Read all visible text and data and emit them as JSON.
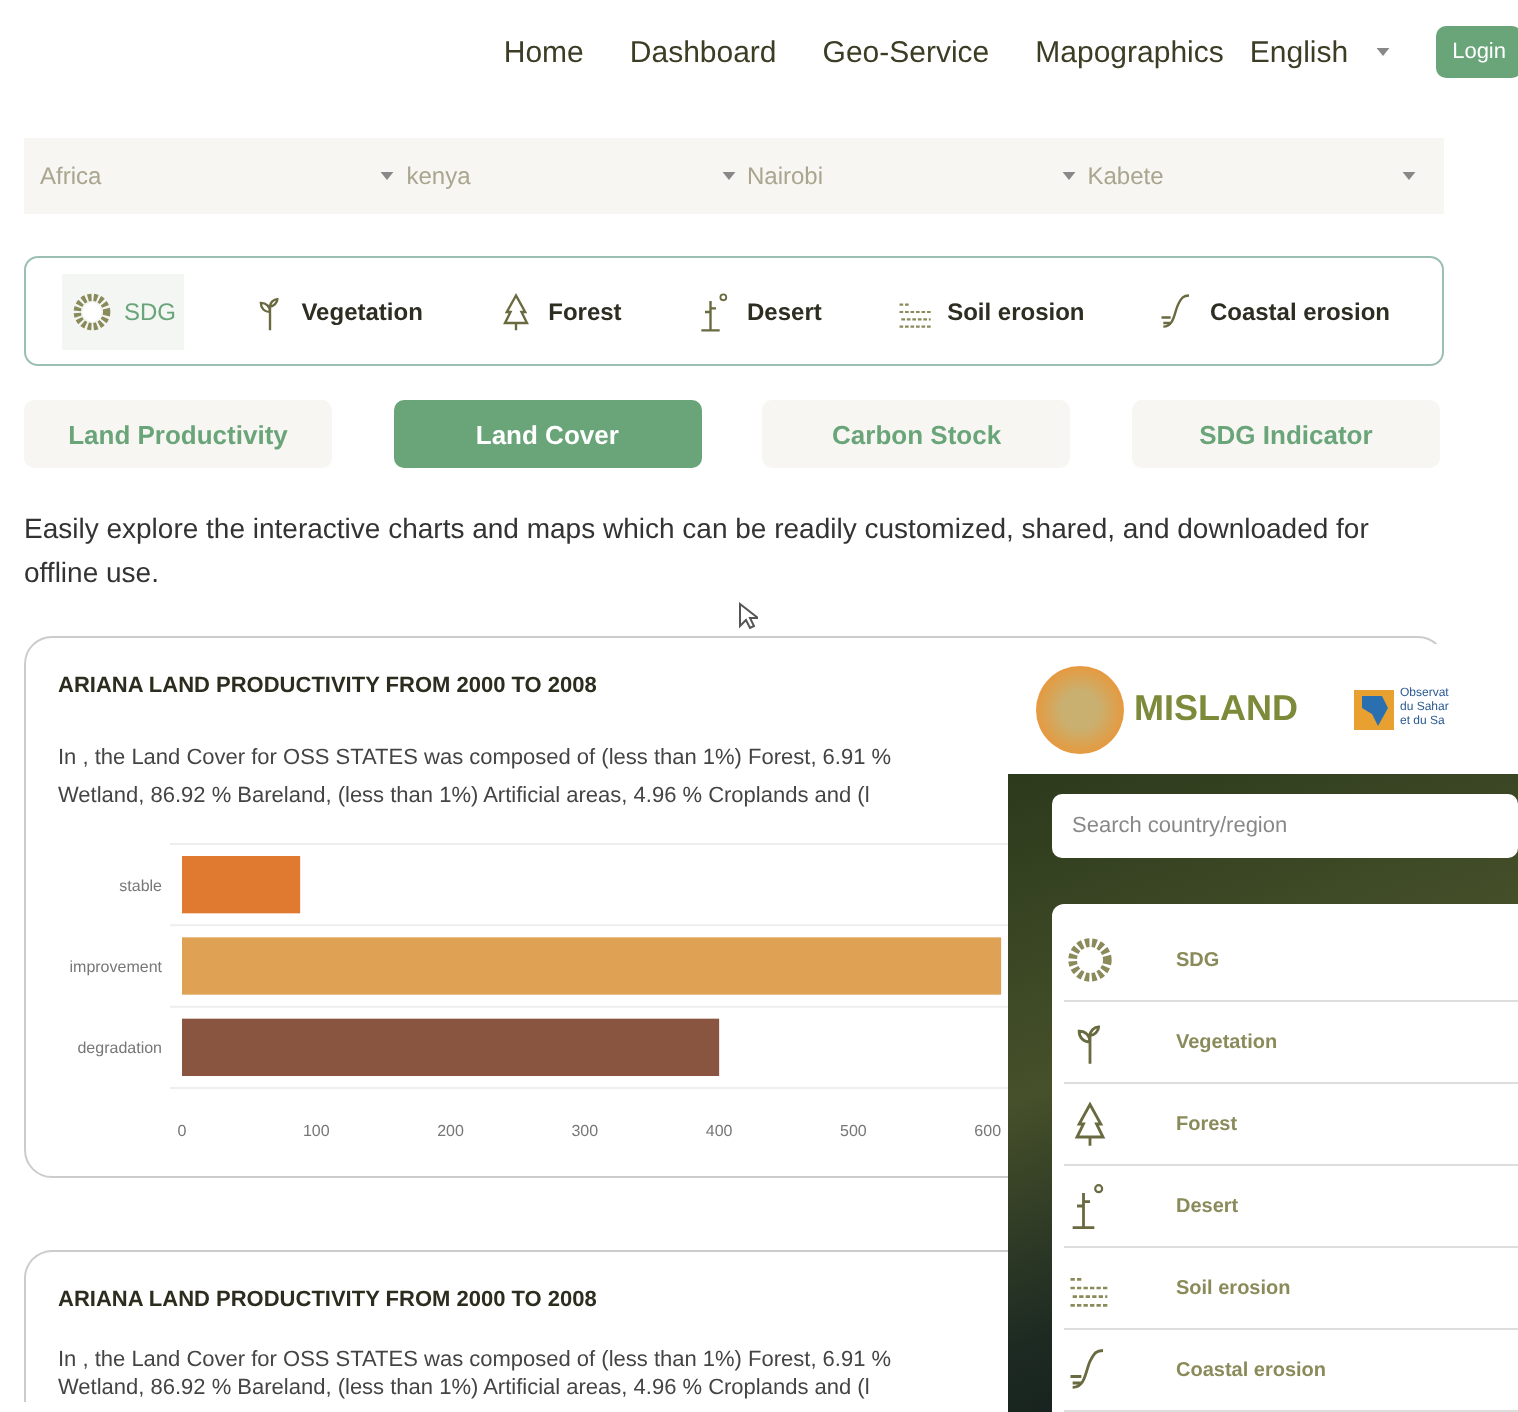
{
  "nav": {
    "links": [
      {
        "label": "Home"
      },
      {
        "label": "Dashboard"
      },
      {
        "label": "Geo-Service"
      },
      {
        "label": "Mapographics"
      }
    ],
    "language": "English",
    "login": "Login"
  },
  "filters": [
    {
      "value": "Africa"
    },
    {
      "value": "kenya"
    },
    {
      "value": "Nairobi"
    },
    {
      "value": "Kabete"
    }
  ],
  "themes": [
    {
      "kind": "sdg",
      "label": "SDG",
      "selected": true
    },
    {
      "kind": "vegetation",
      "label": "Vegetation",
      "selected": false
    },
    {
      "kind": "forest",
      "label": "Forest",
      "selected": false
    },
    {
      "kind": "desert",
      "label": "Desert",
      "selected": false
    },
    {
      "kind": "soil",
      "label": "Soil erosion",
      "selected": false
    },
    {
      "kind": "coastal",
      "label": "Coastal erosion",
      "selected": false
    }
  ],
  "tabs": [
    {
      "label": "Land Productivity",
      "selected": false
    },
    {
      "label": "Land Cover",
      "selected": true
    },
    {
      "label": "Carbon Stock",
      "selected": false
    },
    {
      "label": "SDG Indicator",
      "selected": false
    }
  ],
  "intro": "Easily explore the interactive charts and maps which can be readily customized, shared, and downloaded for offline use.",
  "cards": [
    {
      "title": "ARIANA LAND PRODUCTIVITY FROM 2000 TO 2008",
      "lines": [
        "In , the Land Cover for OSS STATES was composed of (less than 1%) Forest, 6.91 %",
        "Wetland, 86.92 % Bareland, (less than 1%) Artificial areas, 4.96 % Croplands and (l"
      ],
      "chart_data": {
        "type": "bar",
        "orientation": "horizontal",
        "categories": [
          "stable",
          "improvement",
          "degradation"
        ],
        "values": [
          88,
          610,
          400
        ],
        "xlim": [
          0,
          700
        ],
        "xticks": [
          0,
          100,
          200,
          300,
          400,
          500,
          600
        ]
      }
    },
    {
      "title": "ARIANA LAND PRODUCTIVITY FROM 2000 TO 2008",
      "lines": [
        "In , the Land Cover for OSS STATES was composed of (less than 1%) Forest, 6.91 %",
        "Wetland, 86.92 % Bareland, (less than 1%) Artificial areas, 4.96 % Croplands and (l"
      ]
    }
  ],
  "overlay": {
    "brand": "MISLAND",
    "partner_lines": [
      "Observat",
      "du Sahar",
      "et du Sa"
    ],
    "search": {
      "placeholder": "Search country/region"
    },
    "items": [
      {
        "kind": "sdg",
        "label": "SDG"
      },
      {
        "kind": "vegetation",
        "label": "Vegetation"
      },
      {
        "kind": "forest",
        "label": "Forest"
      },
      {
        "kind": "desert",
        "label": "Desert"
      },
      {
        "kind": "soil",
        "label": "Soil erosion"
      },
      {
        "kind": "coastal",
        "label": "Coastal erosion"
      }
    ]
  }
}
